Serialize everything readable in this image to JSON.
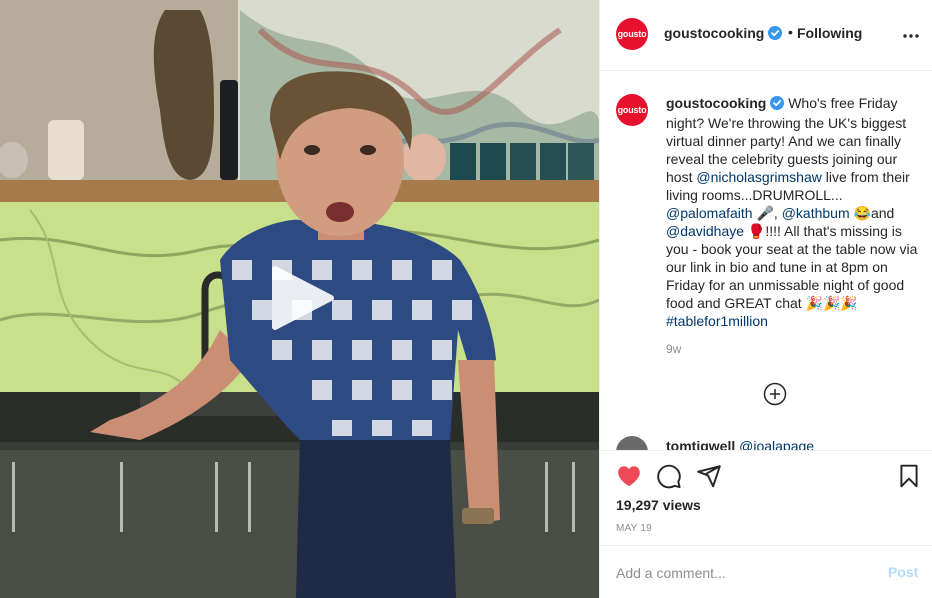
{
  "post": {
    "username": "goustocooking",
    "avatar_text": "gousto",
    "separator": "•",
    "follow_status": "Following",
    "media": {
      "type": "video",
      "play_icon": "play-icon"
    }
  },
  "caption": {
    "username": "goustocooking",
    "parts": [
      {
        "text": " Who's free Friday night? We're throwing the UK's biggest virtual dinner party! And we can finally reveal the celebrity guests joining our host ",
        "type": "text"
      },
      {
        "text": "@nicholasgrimshaw",
        "type": "mention"
      },
      {
        "text": " live from their living rooms...DRUMROLL... ",
        "type": "text"
      },
      {
        "text": "@palomafaith",
        "type": "mention"
      },
      {
        "text": " 🎤, ",
        "type": "text"
      },
      {
        "text": "@kathbum",
        "type": "mention"
      },
      {
        "text": " 😂and ",
        "type": "text"
      },
      {
        "text": "@davidhaye",
        "type": "mention"
      },
      {
        "text": " 🥊!!!! All that's missing is you - book your seat at the table now via our link in bio and tune in at 8pm on Friday for an unmissable night of good food and GREAT chat 🎉🎉🎉 ",
        "type": "text"
      },
      {
        "text": "#tablefor1million",
        "type": "hashtag"
      }
    ],
    "time_ago": "9w"
  },
  "next_comment": {
    "username": "tomtigwell",
    "mention": "@joalapage"
  },
  "actions": {
    "like_icon": "heart-filled-icon",
    "comment_icon": "comment-icon",
    "share_icon": "share-icon",
    "save_icon": "bookmark-icon",
    "like_color": "#ed4956"
  },
  "stats": {
    "views": "19,297 views",
    "date": "MAY 19"
  },
  "comment_box": {
    "placeholder": "Add a comment...",
    "post_label": "Post",
    "post_color": "#b3dbff"
  },
  "colors": {
    "brand": "#e8112d",
    "verified": "#3897f0",
    "link": "#00376b",
    "muted": "#8e8e8e"
  }
}
